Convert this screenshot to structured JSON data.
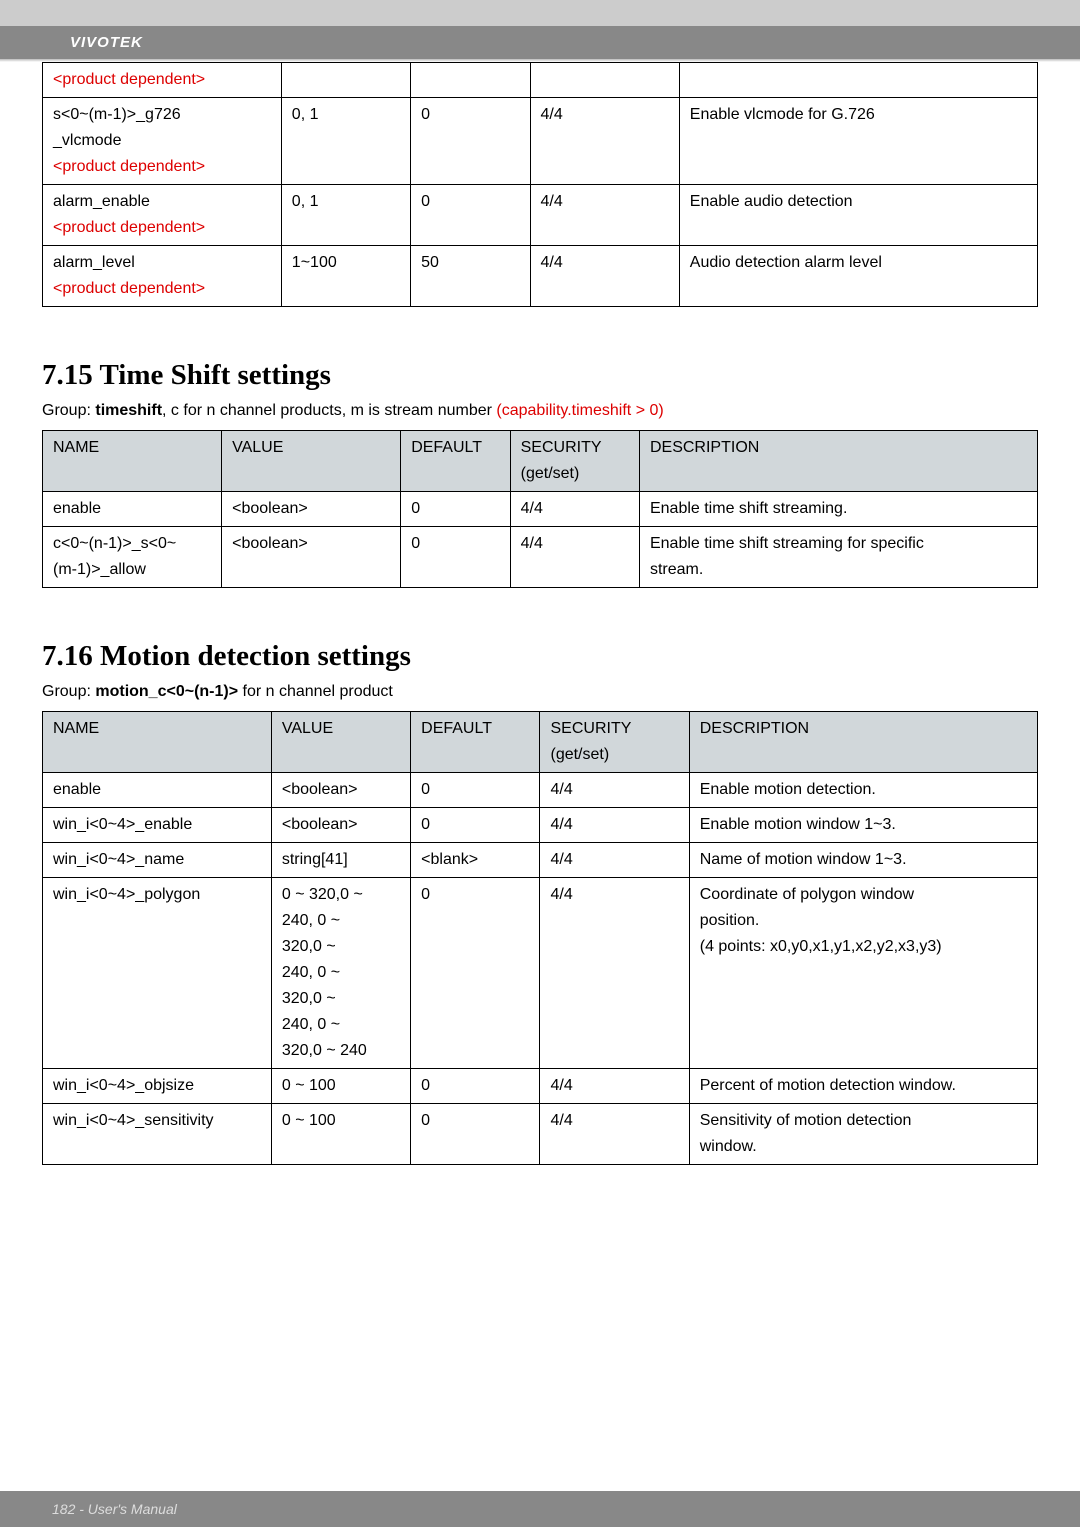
{
  "brand": "VIVOTEK",
  "footer": "182 - User's Manual",
  "headers": {
    "NAME": "NAME",
    "VALUE": "VALUE",
    "DEFAULT": "DEFAULT",
    "SECURITY": "SECURITY",
    "SECURITY_SUB": "(get/set)",
    "DESCRIPTION": "DESCRIPTION"
  },
  "table1": {
    "r1": {
      "name_a": "<product dependent>"
    },
    "r2": {
      "name_a": "s<0~(m-1)>_g726",
      "name_b": "_vlcmode",
      "name_c": "<product dependent>",
      "value": "0, 1",
      "default": "0",
      "security": "4/4",
      "desc": "Enable vlcmode for G.726"
    },
    "r3": {
      "name_a": "alarm_enable",
      "name_b": "<product dependent>",
      "value": "0, 1",
      "default": "0",
      "security": "4/4",
      "desc": "Enable audio detection"
    },
    "r4": {
      "name_a": "alarm_level",
      "name_b": "<product dependent>",
      "value": "1~100",
      "default": "50",
      "security": "4/4",
      "desc": "Audio detection alarm level"
    }
  },
  "section715": {
    "title": "7.15 Time Shift settings",
    "group_a": "Group: ",
    "group_b": "timeshift",
    "group_c": ", c for n channel products, m is stream number ",
    "group_d": "(capability.timeshift > 0)"
  },
  "table2": {
    "r1": {
      "name": "enable",
      "value": "<boolean>",
      "default": "0",
      "security": "4/4",
      "desc": "Enable time shift streaming."
    },
    "r2": {
      "name_a": "c<0~(n-1)>_s<0~",
      "name_b": "(m-1)>_allow",
      "value": "<boolean>",
      "default": "0",
      "security": "4/4",
      "desc_a": "Enable time shift streaming for specific",
      "desc_b": "stream."
    }
  },
  "section716": {
    "title": "7.16 Motion detection settings",
    "group_a": "Group: ",
    "group_b": "motion_c<0~(n-1)>",
    "group_c": " for n channel product"
  },
  "table3": {
    "r1": {
      "name": "enable",
      "value": "<boolean>",
      "default": "0",
      "security": "4/4",
      "desc": "Enable motion detection."
    },
    "r2": {
      "name": "win_i<0~4>_enable",
      "value": "<boolean>",
      "default": "0",
      "security": "4/4",
      "desc": "Enable motion window 1~3."
    },
    "r3": {
      "name": "win_i<0~4>_name",
      "value": "string[41]",
      "default": "<blank>",
      "security": "4/4",
      "desc": "Name of motion window 1~3."
    },
    "r4": {
      "name": "win_i<0~4>_polygon",
      "v1": "0 ~ 320,0 ~",
      "v2": "240, 0 ~",
      "v3": "320,0 ~",
      "v4": "240, 0 ~",
      "v5": "320,0 ~",
      "v6": "240, 0 ~",
      "v7": "320,0 ~ 240",
      "default": "0",
      "security": "4/4",
      "d1": "Coordinate of polygon window",
      "d2": "position.",
      "d3": "(4 points: x0,y0,x1,y1,x2,y2,x3,y3)"
    },
    "r5": {
      "name": "win_i<0~4>_objsize",
      "value": "0 ~ 100",
      "default": "0",
      "security": "4/4",
      "desc": "Percent of motion detection window."
    },
    "r6": {
      "name": "win_i<0~4>_sensitivity",
      "value": "0 ~ 100",
      "default": "0",
      "security": "4/4",
      "d1": "Sensitivity of motion detection",
      "d2": "window."
    }
  }
}
